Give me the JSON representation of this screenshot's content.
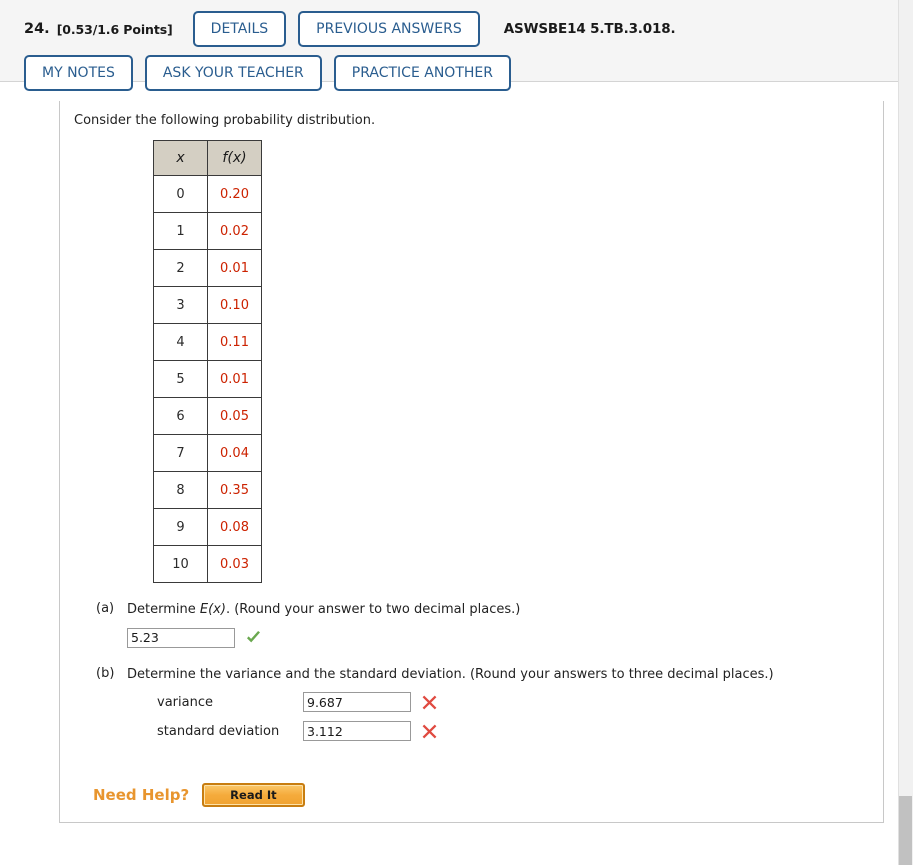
{
  "header": {
    "question_number": "24.",
    "points": "[0.53/1.6 Points]",
    "details_label": "DETAILS",
    "previous_answers_label": "PREVIOUS ANSWERS",
    "source_code": "ASWSBE14 5.TB.3.018.",
    "my_notes_label": "MY NOTES",
    "ask_your_teacher_label": "ASK YOUR TEACHER",
    "practice_another_label": "PRACTICE ANOTHER"
  },
  "content": {
    "prompt": "Consider the following probability distribution.",
    "table": {
      "headers": [
        "x",
        "f(x)"
      ],
      "x_values": [
        "0",
        "1",
        "2",
        "3",
        "4",
        "5",
        "6",
        "7",
        "8",
        "9",
        "10"
      ],
      "fx_values": [
        "0.20",
        "0.02",
        "0.01",
        "0.10",
        "0.11",
        "0.01",
        "0.05",
        "0.04",
        "0.35",
        "0.08",
        "0.03"
      ]
    },
    "parts": [
      {
        "label": "(a)",
        "text_before": "Determine ",
        "math": "E(x)",
        "text_after": ". (Round your answer to two decimal places.)",
        "answer_value": "5.23",
        "status": "correct",
        "status_icon": "green-check-icon"
      },
      {
        "label": "(b)",
        "text_before": "Determine the variance and the standard deviation. (Round your answers to three decimal places.)",
        "fields": [
          {
            "label": "variance",
            "value": "9.687",
            "status": "incorrect",
            "status_icon": "red-x-icon"
          },
          {
            "label": "standard deviation",
            "value": "3.112",
            "status": "incorrect",
            "status_icon": "red-x-icon"
          }
        ]
      }
    ],
    "need_help": {
      "label": "Need Help?",
      "button_label": "Read It"
    }
  },
  "colors": {
    "button_blue": "#2a5d8f",
    "fx_red": "#cc2200",
    "table_header_tan": "#d4cfc3",
    "need_help_orange": "#e8952e",
    "read_it_gold": "#f5ab3c",
    "check_green": "#6aa84f",
    "x_red": "#e04a40"
  },
  "chart_data": {
    "type": "table",
    "title": "Probability distribution",
    "categories": [
      "0",
      "1",
      "2",
      "3",
      "4",
      "5",
      "6",
      "7",
      "8",
      "9",
      "10"
    ],
    "values": [
      0.2,
      0.02,
      0.01,
      0.1,
      0.11,
      0.01,
      0.05,
      0.04,
      0.35,
      0.08,
      0.03
    ],
    "xlabel": "x",
    "ylabel": "f(x)"
  }
}
